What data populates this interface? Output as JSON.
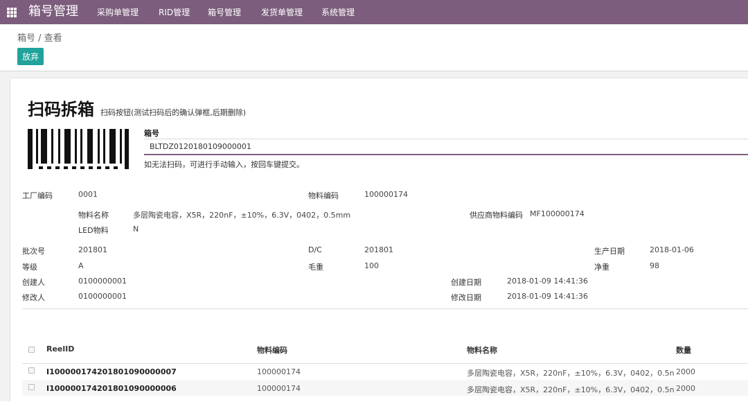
{
  "navbar": {
    "app_title": "箱号管理",
    "menus": [
      "采购单管理",
      "RID管理",
      "箱号管理",
      "发货单管理",
      "系统管理"
    ]
  },
  "control_panel": {
    "breadcrumb": "箱号 / 查看",
    "discard_label": "放弃"
  },
  "form": {
    "title": "扫码拆箱",
    "subtitle": "扫码按钮(测试扫码后的确认弹框,后期删除)",
    "box_label": "箱号",
    "box_value": "BLTDZ0120180109000001",
    "box_hint": "如无法扫码，可进行手动输入，按回车键提交。",
    "fields": {
      "factory_code": {
        "label": "工厂编码",
        "value": "0001"
      },
      "material_code": {
        "label": "物料编码",
        "value": "100000174"
      },
      "material_name": {
        "label": "物料名称",
        "value": "多层陶瓷电容，X5R，220nF，±10%，6.3V，0402，0.5mm"
      },
      "supplier_material_code": {
        "label": "供应商物料编码",
        "value": "MF100000174"
      },
      "led_material": {
        "label": "LED物料",
        "value": "N"
      },
      "batch_no": {
        "label": "批次号",
        "value": "201801"
      },
      "dc": {
        "label": "D/C",
        "value": "201801"
      },
      "production_date": {
        "label": "生产日期",
        "value": "2018-01-06"
      },
      "grade": {
        "label": "等级",
        "value": "A"
      },
      "gross_weight": {
        "label": "毛重",
        "value": "100"
      },
      "net_weight": {
        "label": "净重",
        "value": "98"
      },
      "creator": {
        "label": "创建人",
        "value": "0100000001"
      },
      "create_date": {
        "label": "创建日期",
        "value": "2018-01-09 14:41:36"
      },
      "modifier": {
        "label": "修改人",
        "value": "0100000001"
      },
      "modify_date": {
        "label": "修改日期",
        "value": "2018-01-09 14:41:36"
      }
    }
  },
  "table": {
    "headers": {
      "reel_id": "ReelID",
      "material_code": "物料编码",
      "material_name": "物料名称",
      "quantity": "数量"
    },
    "rows": [
      {
        "reel_id": "I100000174201801090000007",
        "material_code": "100000174",
        "material_name": "多层陶瓷电容，X5R，220nF，±10%，6.3V，0402，0.5n",
        "quantity": "2000"
      },
      {
        "reel_id": "I100000174201801090000006",
        "material_code": "100000174",
        "material_name": "多层陶瓷电容，X5R，220nF，±10%，6.3V，0402，0.5n",
        "quantity": "2000"
      }
    ]
  },
  "colors": {
    "navbar": "#7c5d7d",
    "primary_button": "#21a39b",
    "input_underline": "#7c5d7d"
  }
}
